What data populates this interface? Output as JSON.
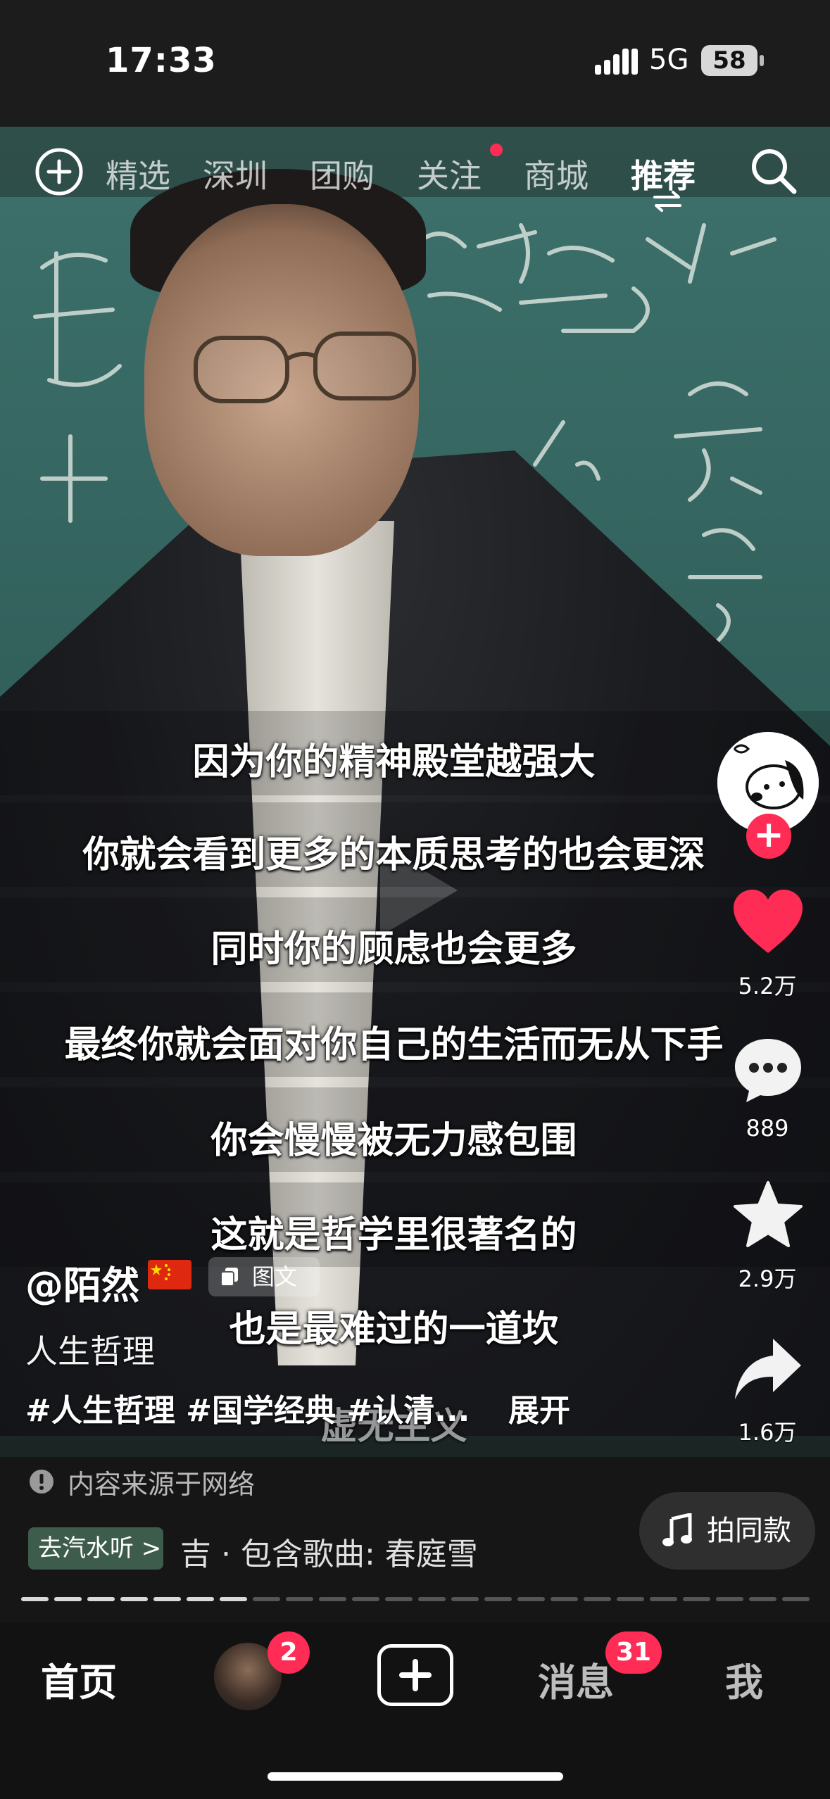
{
  "status_bar": {
    "time": "17:33",
    "network": "5G",
    "battery": "58"
  },
  "top_nav": {
    "tabs": [
      {
        "label": "精选",
        "active": false
      },
      {
        "label": "深圳",
        "active": false
      },
      {
        "label": "团购",
        "active": false
      },
      {
        "label": "关注",
        "active": false,
        "has_dot": true
      },
      {
        "label": "商城",
        "active": false
      },
      {
        "label": "推荐",
        "active": true
      }
    ]
  },
  "subtitles": [
    "因为你的精神殿堂越强大",
    "你就会看到更多的本质思考的也会更深",
    "同时你的顾虑也会更多",
    "最终你就会面对你自己的生活而无从下手",
    "你会慢慢被无力感包围",
    "这就是哲学里很著名的",
    "也是最难过的一道坎",
    "虚无主义"
  ],
  "right_rail": {
    "likes": "5.2万",
    "comments": "889",
    "favorites": "2.9万",
    "shares": "1.6万"
  },
  "post": {
    "author": "@陌然",
    "type_badge": "图文",
    "description": "人生哲理",
    "tags": "#人生哲理 #国学经典 #认清...",
    "expand": "展开"
  },
  "footer_info": {
    "source_note": "内容来源于网络",
    "listen_button": "去汽水听 >",
    "music_text": "吉 · 包含歌曲: 春庭雪",
    "same_button": "拍同款",
    "progress_segments": 24,
    "progress_done": 7
  },
  "tab_bar": {
    "home": "首页",
    "friends_badge": "2",
    "messages": "消息",
    "messages_badge": "31",
    "me": "我"
  },
  "colors": {
    "accent": "#ff2c55",
    "background": "#161616",
    "listen_green": "#3e5c4b"
  }
}
